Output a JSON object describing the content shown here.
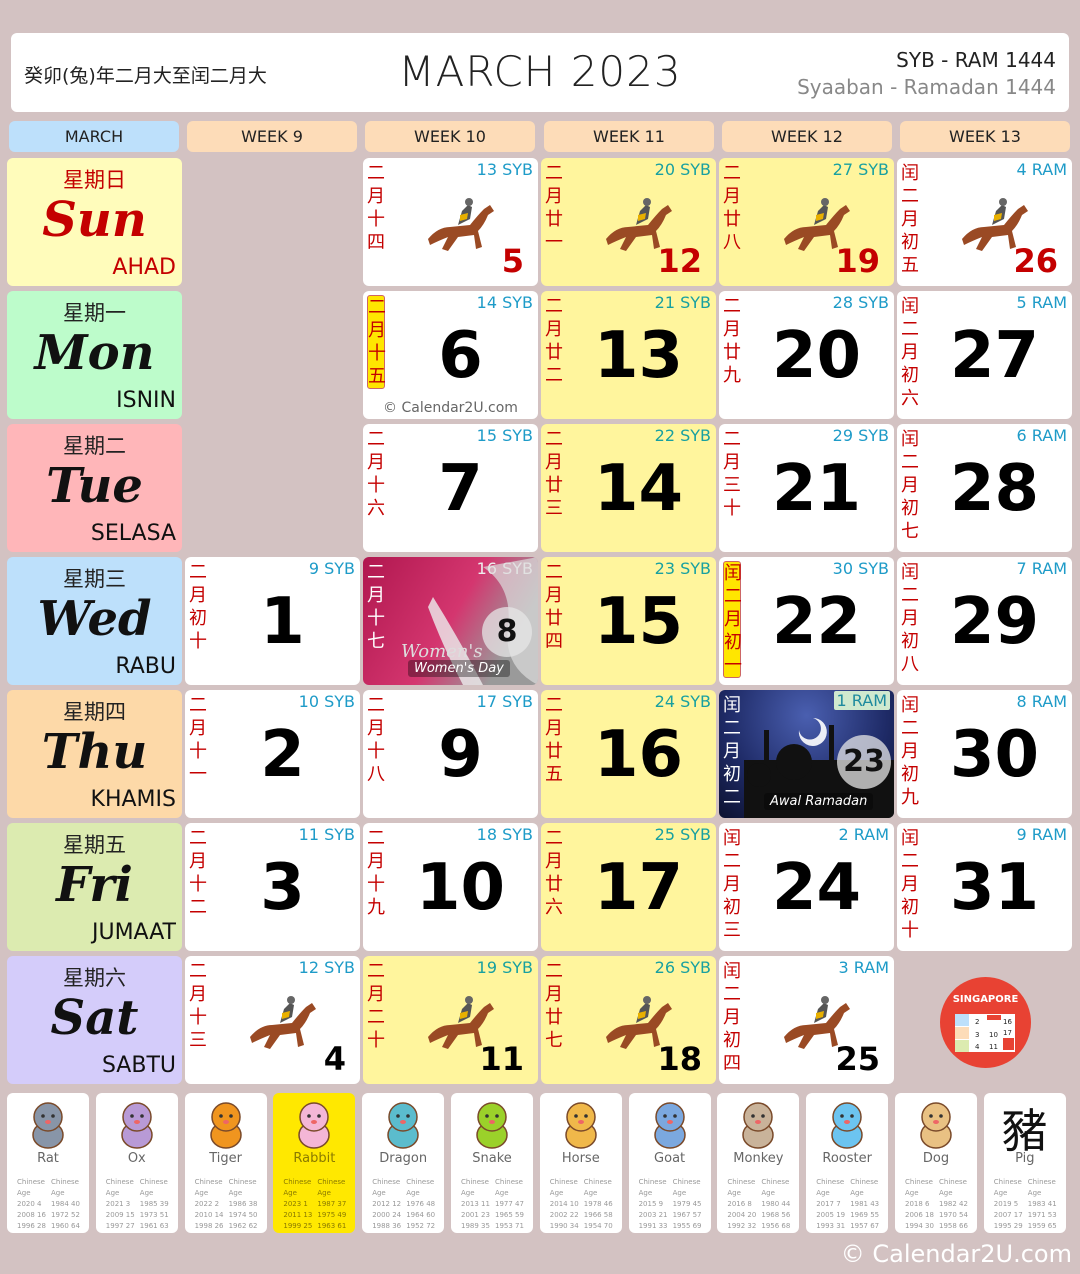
{
  "header": {
    "lunar_range": "癸卯(兔)年二月大至闰二月大",
    "title": "MARCH 2023",
    "hijri_short": "SYB - RAM 1444",
    "hijri_long": "Syaaban - Ramadan 1444"
  },
  "columns": {
    "month": "MARCH",
    "weeks": [
      "WEEK 9",
      "WEEK 10",
      "WEEK 11",
      "WEEK 12",
      "WEEK 13"
    ]
  },
  "days": [
    {
      "cn": "星期日",
      "en": "Sun",
      "my": "AHAD"
    },
    {
      "cn": "星期一",
      "en": "Mon",
      "my": "ISNIN"
    },
    {
      "cn": "星期二",
      "en": "Tue",
      "my": "SELASA"
    },
    {
      "cn": "星期三",
      "en": "Wed",
      "my": "RABU"
    },
    {
      "cn": "星期四",
      "en": "Thu",
      "my": "KHAMIS"
    },
    {
      "cn": "星期五",
      "en": "Fri",
      "my": "JUMAAT"
    },
    {
      "cn": "星期六",
      "en": "Sat",
      "my": "SABTU"
    }
  ],
  "cells": [
    {
      "id": "d1",
      "day": "1",
      "hijri": "9 SYB",
      "lunar": "二月初十"
    },
    {
      "id": "d2",
      "day": "2",
      "hijri": "10 SYB",
      "lunar": "二月十一"
    },
    {
      "id": "d3",
      "day": "3",
      "hijri": "11 SYB",
      "lunar": "二月十二"
    },
    {
      "id": "d4",
      "day": "4",
      "hijri": "12 SYB",
      "lunar": "二月十三",
      "icon": "horse-racing"
    },
    {
      "id": "d5",
      "day": "5",
      "hijri": "13 SYB",
      "lunar": "二月十四",
      "icon": "horse-racing"
    },
    {
      "id": "d6",
      "day": "6",
      "hijri": "14 SYB",
      "lunar": "二月十五",
      "highlight_lunar": true,
      "watermark": "© Calendar2U.com"
    },
    {
      "id": "d7",
      "day": "7",
      "hijri": "15 SYB",
      "lunar": "二月十六"
    },
    {
      "id": "d8",
      "day": "8",
      "hijri": "16 SYB",
      "lunar": "二月十七",
      "event": "Women's Day"
    },
    {
      "id": "d9",
      "day": "9",
      "hijri": "17 SYB",
      "lunar": "二月十八"
    },
    {
      "id": "d10",
      "day": "10",
      "hijri": "18 SYB",
      "lunar": "二月十九"
    },
    {
      "id": "d11",
      "day": "11",
      "hijri": "19 SYB",
      "lunar": "二月二十",
      "icon": "horse-racing"
    },
    {
      "id": "d12",
      "day": "12",
      "hijri": "20 SYB",
      "lunar": "二月廿一",
      "icon": "horse-racing"
    },
    {
      "id": "d13",
      "day": "13",
      "hijri": "21 SYB",
      "lunar": "二月廿二"
    },
    {
      "id": "d14",
      "day": "14",
      "hijri": "22 SYB",
      "lunar": "二月廿三"
    },
    {
      "id": "d15",
      "day": "15",
      "hijri": "23 SYB",
      "lunar": "二月廿四"
    },
    {
      "id": "d16",
      "day": "16",
      "hijri": "24 SYB",
      "lunar": "二月廿五"
    },
    {
      "id": "d17",
      "day": "17",
      "hijri": "25 SYB",
      "lunar": "二月廿六"
    },
    {
      "id": "d18",
      "day": "18",
      "hijri": "26 SYB",
      "lunar": "二月廿七",
      "icon": "horse-racing"
    },
    {
      "id": "d19",
      "day": "19",
      "hijri": "27 SYB",
      "lunar": "二月廿八",
      "icon": "horse-racing"
    },
    {
      "id": "d20",
      "day": "20",
      "hijri": "28 SYB",
      "lunar": "二月廿九"
    },
    {
      "id": "d21",
      "day": "21",
      "hijri": "29 SYB",
      "lunar": "二月三十"
    },
    {
      "id": "d22",
      "day": "22",
      "hijri": "30 SYB",
      "lunar": "闰二月初一",
      "highlight_lunar": true
    },
    {
      "id": "d23",
      "day": "23",
      "hijri": "1 RAM",
      "lunar": "闰二月初二",
      "event": "Awal Ramadan"
    },
    {
      "id": "d24",
      "day": "24",
      "hijri": "2 RAM",
      "lunar": "闰二月初三"
    },
    {
      "id": "d25",
      "day": "25",
      "hijri": "3 RAM",
      "lunar": "闰二月初四",
      "icon": "horse-racing"
    },
    {
      "id": "d26",
      "day": "26",
      "hijri": "4 RAM",
      "lunar": "闰二月初五",
      "icon": "horse-racing"
    },
    {
      "id": "d27",
      "day": "27",
      "hijri": "5 RAM",
      "lunar": "闰二月初六"
    },
    {
      "id": "d28",
      "day": "28",
      "hijri": "6 RAM",
      "lunar": "闰二月初七"
    },
    {
      "id": "d29",
      "day": "29",
      "hijri": "7 RAM",
      "lunar": "闰二月初八"
    },
    {
      "id": "d30",
      "day": "30",
      "hijri": "8 RAM",
      "lunar": "闰二月初九"
    },
    {
      "id": "d31",
      "day": "31",
      "hijri": "9 RAM",
      "lunar": "闰二月初十"
    }
  ],
  "badge": {
    "label": "SINGAPORE"
  },
  "zodiac": {
    "header1": "Chinese",
    "header2": "Age",
    "animals": [
      {
        "name": "Rat",
        "rows": [
          [
            "2020",
            "4",
            "1984",
            "40"
          ],
          [
            "2008",
            "16",
            "1972",
            "52"
          ],
          [
            "1996",
            "28",
            "1960",
            "64"
          ]
        ]
      },
      {
        "name": "Ox",
        "rows": [
          [
            "2021",
            "3",
            "1985",
            "39"
          ],
          [
            "2009",
            "15",
            "1973",
            "51"
          ],
          [
            "1997",
            "27",
            "1961",
            "63"
          ]
        ]
      },
      {
        "name": "Tiger",
        "rows": [
          [
            "2022",
            "2",
            "1986",
            "38"
          ],
          [
            "2010",
            "14",
            "1974",
            "50"
          ],
          [
            "1998",
            "26",
            "1962",
            "62"
          ]
        ]
      },
      {
        "name": "Rabbit",
        "active": true,
        "rows": [
          [
            "2023",
            "1",
            "1987",
            "37"
          ],
          [
            "2011",
            "13",
            "1975",
            "49"
          ],
          [
            "1999",
            "25",
            "1963",
            "61"
          ]
        ]
      },
      {
        "name": "Dragon",
        "rows": [
          [
            "2012",
            "12",
            "1976",
            "48"
          ],
          [
            "2000",
            "24",
            "1964",
            "60"
          ],
          [
            "1988",
            "36",
            "1952",
            "72"
          ]
        ]
      },
      {
        "name": "Snake",
        "rows": [
          [
            "2013",
            "11",
            "1977",
            "47"
          ],
          [
            "2001",
            "23",
            "1965",
            "59"
          ],
          [
            "1989",
            "35",
            "1953",
            "71"
          ]
        ]
      },
      {
        "name": "Horse",
        "rows": [
          [
            "2014",
            "10",
            "1978",
            "46"
          ],
          [
            "2002",
            "22",
            "1966",
            "58"
          ],
          [
            "1990",
            "34",
            "1954",
            "70"
          ]
        ]
      },
      {
        "name": "Goat",
        "rows": [
          [
            "2015",
            "9",
            "1979",
            "45"
          ],
          [
            "2003",
            "21",
            "1967",
            "57"
          ],
          [
            "1991",
            "33",
            "1955",
            "69"
          ]
        ]
      },
      {
        "name": "Monkey",
        "rows": [
          [
            "2016",
            "8",
            "1980",
            "44"
          ],
          [
            "2004",
            "20",
            "1968",
            "56"
          ],
          [
            "1992",
            "32",
            "1956",
            "68"
          ]
        ]
      },
      {
        "name": "Rooster",
        "rows": [
          [
            "2017",
            "7",
            "1981",
            "43"
          ],
          [
            "2005",
            "19",
            "1969",
            "55"
          ],
          [
            "1993",
            "31",
            "1957",
            "67"
          ]
        ]
      },
      {
        "name": "Dog",
        "rows": [
          [
            "2018",
            "6",
            "1982",
            "42"
          ],
          [
            "2006",
            "18",
            "1970",
            "54"
          ],
          [
            "1994",
            "30",
            "1958",
            "66"
          ]
        ]
      },
      {
        "name": "Pig",
        "glyph": "豬",
        "rows": [
          [
            "2019",
            "5",
            "1983",
            "41"
          ],
          [
            "2007",
            "17",
            "1971",
            "53"
          ],
          [
            "1995",
            "29",
            "1959",
            "65"
          ]
        ]
      }
    ]
  },
  "footer": "© Calendar2U.com",
  "colors": {
    "sunday_red": "#c40000",
    "hijri_blue": "#1e9bc8",
    "yellow_week": "#fff59d",
    "background": "#d3c2c2"
  }
}
